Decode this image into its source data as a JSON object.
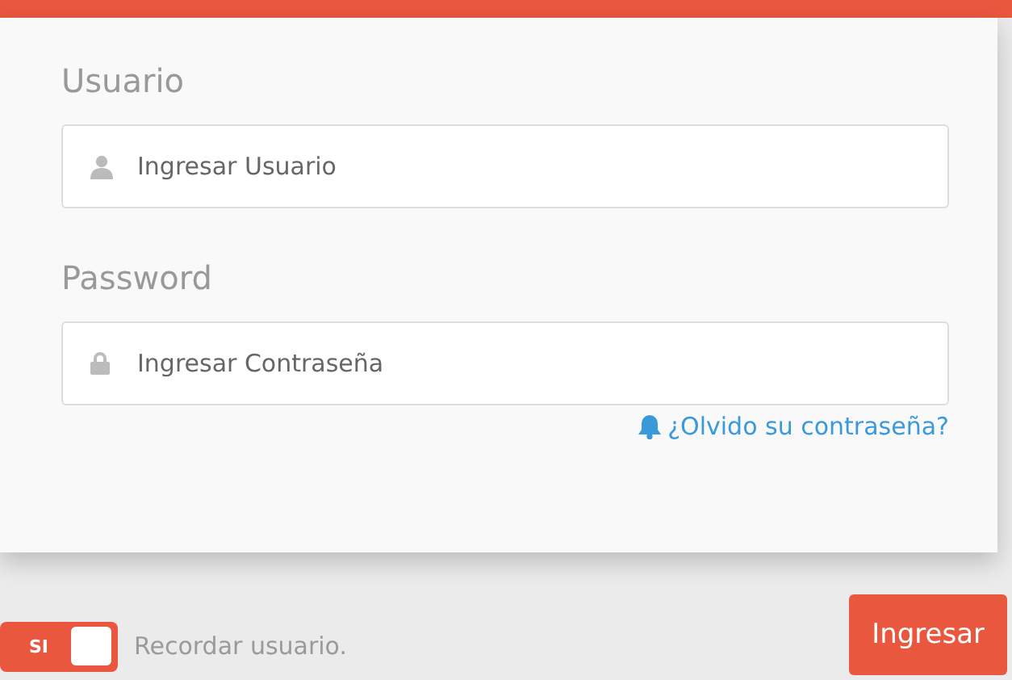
{
  "form": {
    "fields": [
      {
        "label": "Usuario",
        "placeholder": "Ingresar Usuario",
        "kind": "user"
      },
      {
        "label": "Password",
        "placeholder": "Ingresar Contraseña",
        "kind": "password"
      }
    ],
    "forgot_link": "¿Olvido su contraseña?"
  },
  "remember": {
    "toggle_label": "SI",
    "on": true,
    "label": "Recordar usuario."
  },
  "submit": "Ingresar"
}
